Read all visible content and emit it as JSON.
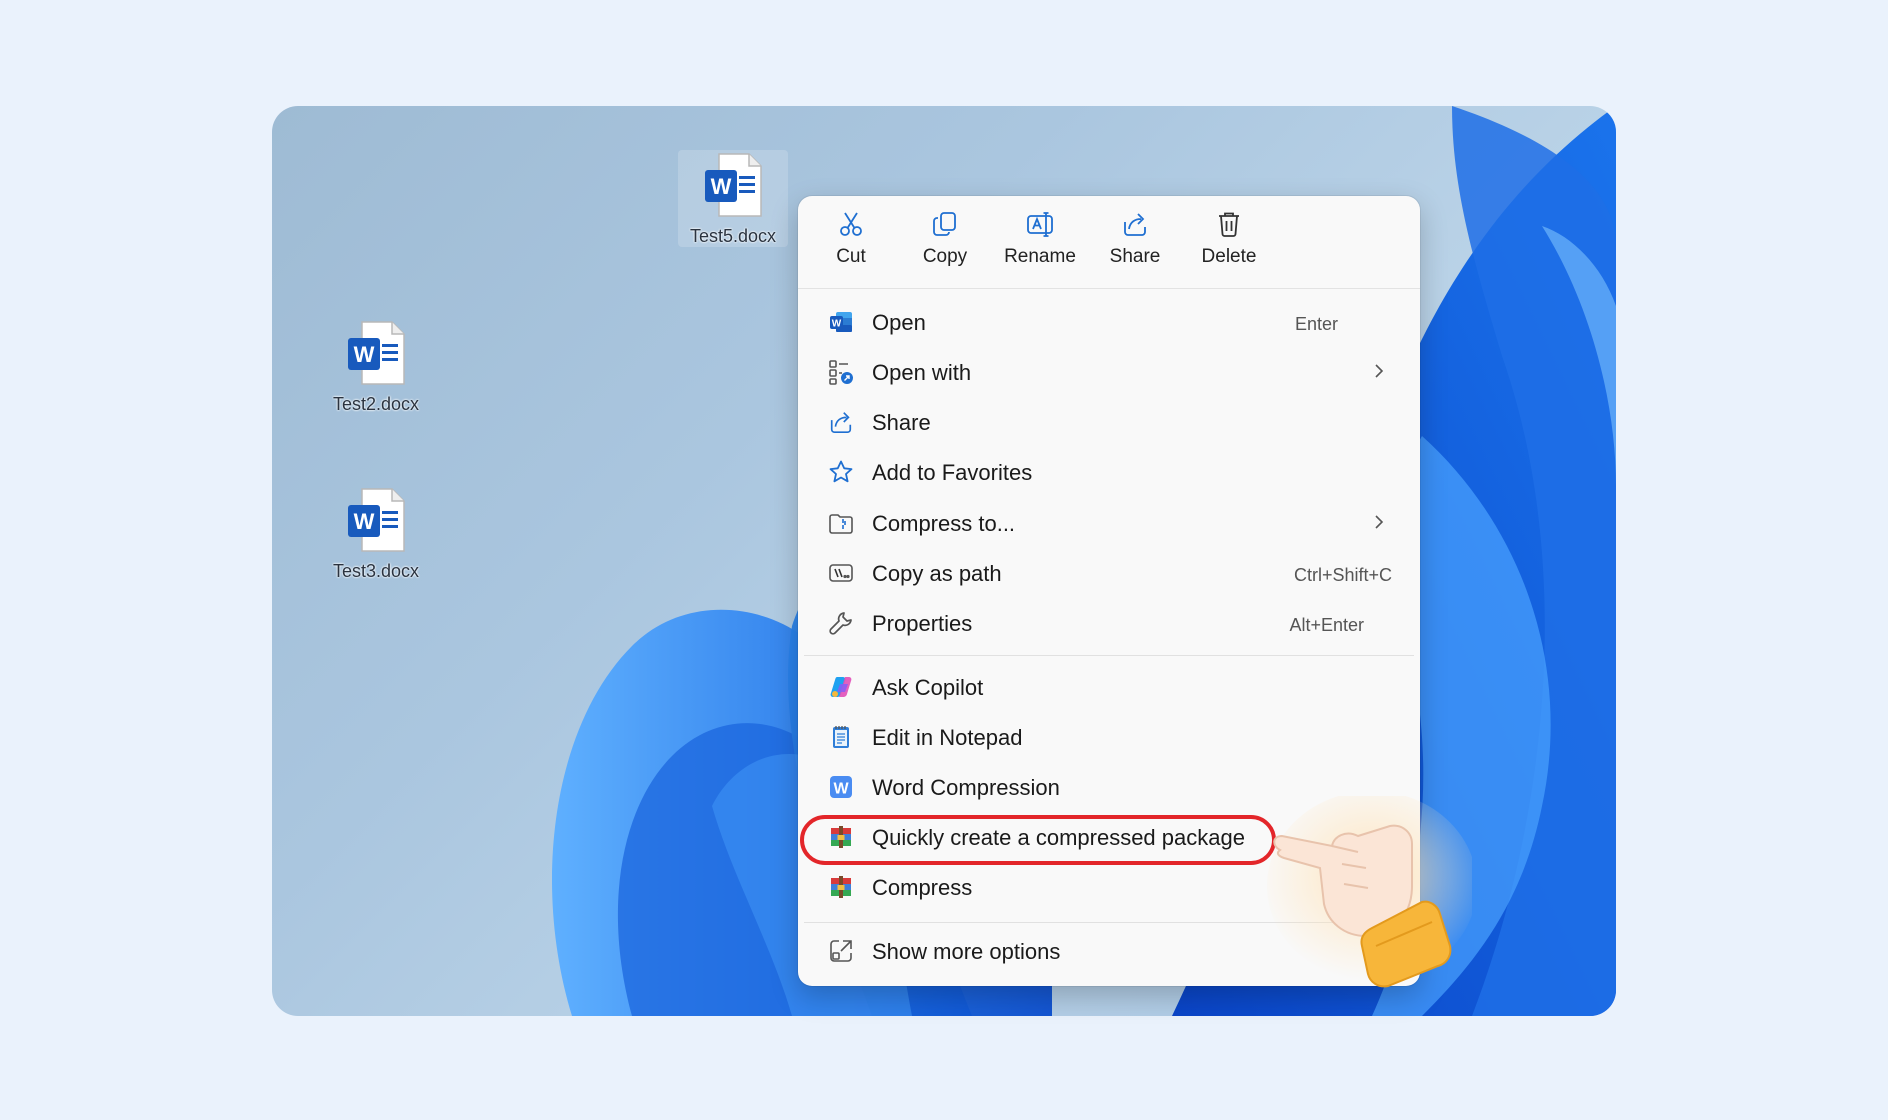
{
  "desktop": {
    "icons": [
      {
        "name": "Test5.docx",
        "glyph": "W"
      },
      {
        "name": "Test2.docx",
        "glyph": "W"
      },
      {
        "name": "Test3.docx",
        "glyph": "W"
      }
    ]
  },
  "context_menu": {
    "toolbar": [
      {
        "label": "Cut",
        "icon": "scissors-icon"
      },
      {
        "label": "Copy",
        "icon": "copy-icon"
      },
      {
        "label": "Rename",
        "icon": "rename-icon"
      },
      {
        "label": "Share",
        "icon": "share-icon"
      },
      {
        "label": "Delete",
        "icon": "trash-icon"
      }
    ],
    "group1": [
      {
        "label": "Open",
        "shortcut": "Enter",
        "icon": "word-icon"
      },
      {
        "label": "Open with",
        "submenu": true,
        "icon": "open-with-icon"
      },
      {
        "label": "Share",
        "icon": "share-icon"
      },
      {
        "label": "Add to Favorites",
        "icon": "star-icon"
      },
      {
        "label": "Compress to...",
        "submenu": true,
        "icon": "zip-folder-icon"
      },
      {
        "label": "Copy as path",
        "shortcut": "Ctrl+Shift+C",
        "icon": "path-icon"
      },
      {
        "label": "Properties",
        "shortcut": "Alt+Enter",
        "icon": "wrench-icon"
      }
    ],
    "group2": [
      {
        "label": "Ask Copilot",
        "icon": "copilot-icon"
      },
      {
        "label": "Edit in Notepad",
        "icon": "notepad-icon"
      },
      {
        "label": "Word Compression",
        "icon": "word-compression-icon"
      },
      {
        "label": "Quickly create a compressed package",
        "icon": "archive-icon",
        "highlighted": true
      },
      {
        "label": "Compress",
        "icon": "archive-icon"
      }
    ],
    "group3": [
      {
        "label": "Show more options",
        "icon": "more-options-icon"
      }
    ]
  },
  "colors": {
    "highlight": "#e3262a",
    "accent": "#1f6fd1",
    "word_blue": "#185abd"
  }
}
